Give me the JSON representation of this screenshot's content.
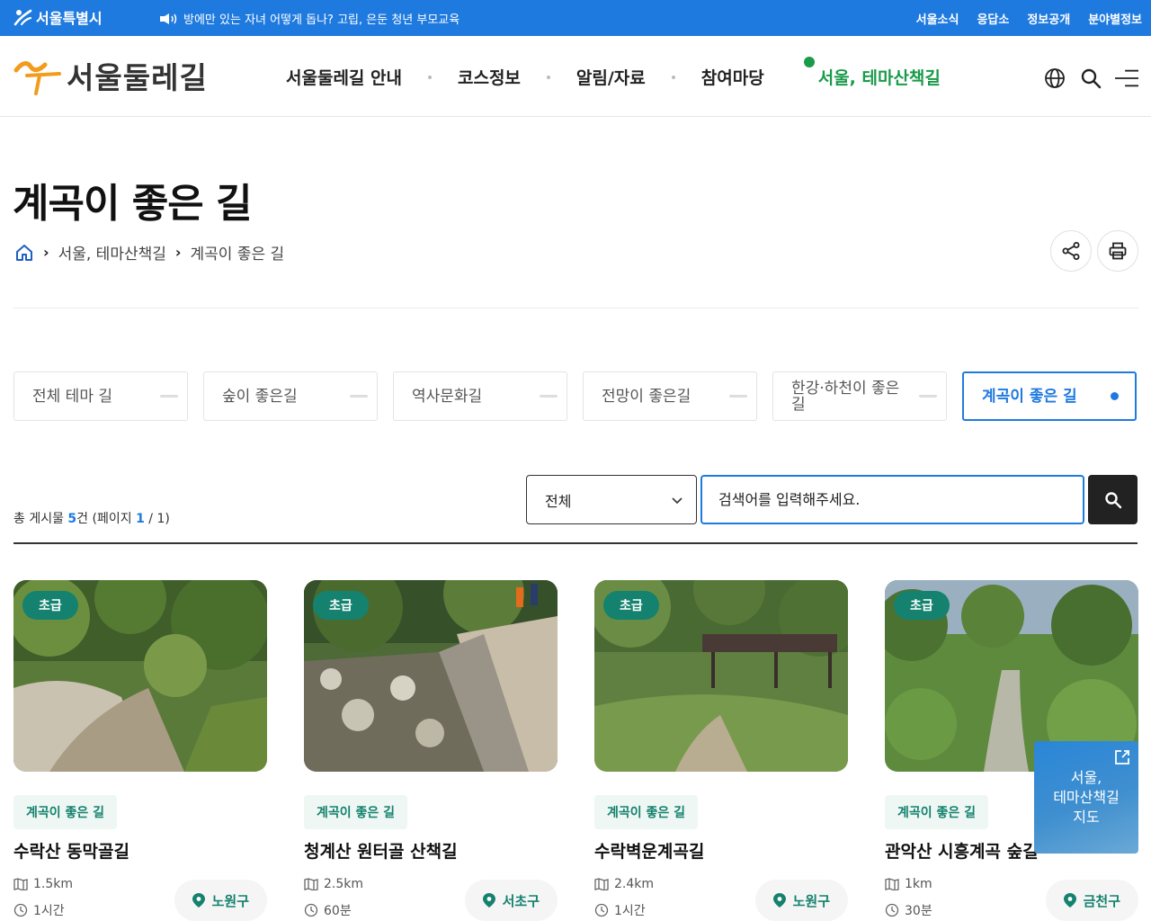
{
  "topbar": {
    "gov_name": "서울특별시",
    "notice": "방에만 있는 자녀 어떻게 돕나? 고립, 은둔 청년 부모교육",
    "links": [
      "서울소식",
      "응답소",
      "정보공개",
      "분야별정보"
    ]
  },
  "header": {
    "brand": "서울둘레길",
    "nav": [
      "서울둘레길 안내",
      "코스정보",
      "알림/자료",
      "참여마당",
      "서울, 테마산책길"
    ],
    "icons": [
      "globe-icon",
      "search-icon",
      "menu-icon"
    ]
  },
  "page": {
    "title": "계곡이 좋은 길",
    "breadcrumb": [
      "서울, 테마산책길",
      "계곡이 좋은 길"
    ]
  },
  "theme_tabs": [
    {
      "label": "전체 테마 길",
      "active": false
    },
    {
      "label": "숲이 좋은길",
      "active": false
    },
    {
      "label": "역사문화길",
      "active": false
    },
    {
      "label": "전망이 좋은길",
      "active": false
    },
    {
      "label": "한강·하천이 좋은길",
      "active": false
    },
    {
      "label": "계곡이 좋은 길",
      "active": true
    }
  ],
  "search": {
    "total_prefix": "총 게시물 ",
    "total_count": "5",
    "total_suffix": "건 (페이지 ",
    "page_current": "1",
    "page_sep": " / ",
    "page_total": "1",
    "page_close": ")",
    "select_value": "전체",
    "placeholder": "검색어를 입력해주세요."
  },
  "cards": [
    {
      "level": "초급",
      "theme": "계곡이 좋은 길",
      "title": "수락산 동막골길",
      "distance": "1.5km",
      "time": "1시간",
      "district": "노원구"
    },
    {
      "level": "초급",
      "theme": "계곡이 좋은 길",
      "title": "청계산 원터골 산책길",
      "distance": "2.5km",
      "time": "60분",
      "district": "서초구"
    },
    {
      "level": "초급",
      "theme": "계곡이 좋은 길",
      "title": "수락벽운계곡길",
      "distance": "2.4km",
      "time": "1시간",
      "district": "노원구"
    },
    {
      "level": "초급",
      "theme": "계곡이 좋은 길",
      "title": "관악산 시흥계곡 숲길",
      "distance": "1km",
      "time": "30분",
      "district": "금천구"
    }
  ],
  "float_map": {
    "line1": "서울,",
    "line2": "테마산책길",
    "line3": "지도"
  },
  "colors": {
    "primary_blue": "#1f7ae0",
    "green": "#1a9a4a",
    "teal": "#14826e"
  }
}
